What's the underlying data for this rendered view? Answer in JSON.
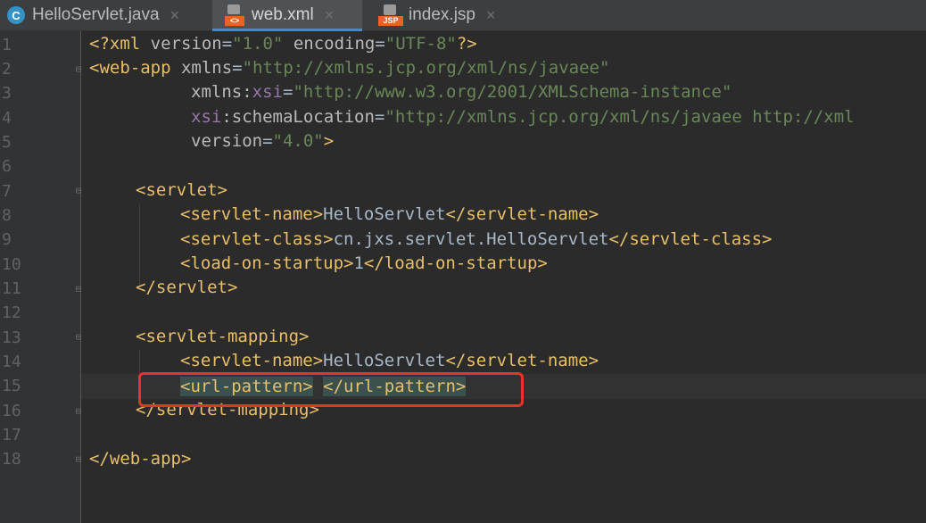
{
  "tabs": [
    {
      "label": "HelloServlet.java",
      "icon": "java-class-icon",
      "active": false
    },
    {
      "label": "web.xml",
      "icon": "xml-file-icon",
      "active": true
    },
    {
      "label": "index.jsp",
      "icon": "jsp-file-icon",
      "active": false
    }
  ],
  "tab_icons": {
    "c": "C",
    "xml": "<>",
    "jsp": "JSP",
    "close": "×"
  },
  "line_numbers": [
    "1",
    "2",
    "3",
    "4",
    "5",
    "6",
    "7",
    "8",
    "9",
    "10",
    "11",
    "12",
    "13",
    "14",
    "15",
    "16",
    "17",
    "18"
  ],
  "code": {
    "l1": {
      "a": "<?xml ",
      "b": "version",
      "c": "=",
      "d": "\"1.0\"",
      "e": " encoding",
      "f": "=",
      "g": "\"UTF-8\"",
      "h": "?>"
    },
    "l2": {
      "a": "<web-app ",
      "b": "xmlns",
      "c": "=",
      "d": "\"http://xmlns.jcp.org/xml/ns/javaee\""
    },
    "l3": {
      "a": "xmlns",
      "b": ":",
      "c": "xsi",
      "d": "=",
      "e": "\"http://www.w3.org/2001/XMLSchema-instance\""
    },
    "l4": {
      "a": "xsi",
      "b": ":schemaLocation",
      "c": "=",
      "d": "\"http://xmlns.jcp.org/xml/ns/javaee http://xml"
    },
    "l5": {
      "a": "version",
      "b": "=",
      "c": "\"4.0\"",
      "d": ">"
    },
    "l7": {
      "a": "<servlet>"
    },
    "l8": {
      "a": "<servlet-name>",
      "b": "HelloServlet",
      "c": "</servlet-name>"
    },
    "l9": {
      "a": "<servlet-class>",
      "b": "cn.jxs.servlet.HelloServlet",
      "c": "</servlet-class>"
    },
    "l10": {
      "a": "<load-on-startup>",
      "b": "1",
      "c": "</load-on-startup>"
    },
    "l11": {
      "a": "</servlet>"
    },
    "l13": {
      "a": "<servlet-mapping>"
    },
    "l14": {
      "a": "<servlet-name>",
      "b": "HelloServlet",
      "c": "</servlet-name>"
    },
    "l15": {
      "a": "<url-pattern>",
      "b": " ",
      "c": "</url-pattern>"
    },
    "l16": {
      "a": "</servlet-mapping>"
    },
    "l18": {
      "a": "</web-app>"
    }
  },
  "colors": {
    "background": "#2b2b2b",
    "tag": "#e8bf6a",
    "string": "#6a8759",
    "namespace": "#9876aa",
    "highlight_box": "#e8322a"
  }
}
